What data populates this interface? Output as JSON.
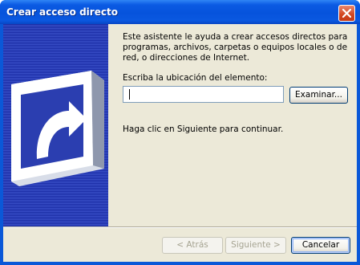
{
  "window": {
    "title": "Crear acceso directo",
    "colors": {
      "titlebar": "#0653dc",
      "client": "#ece9d8",
      "banner": "#1b2da6",
      "close": "#d2451f"
    }
  },
  "titlebar": {
    "close_icon": "close-icon"
  },
  "banner": {
    "icon": "shortcut-arrow-icon"
  },
  "main": {
    "intro_text": "Este asistente le ayuda a crear accesos directos para programas, archivos, carpetas o equipos locales o de red, o direcciones de Internet.",
    "location_label": "Escriba la ubicación del elemento:",
    "location_value": "",
    "browse_label": "Examinar...",
    "continue_text": "Haga clic en Siguiente para continuar."
  },
  "footer": {
    "back_label": "< Atrás",
    "next_label": "Siguiente >",
    "cancel_label": "Cancelar"
  }
}
